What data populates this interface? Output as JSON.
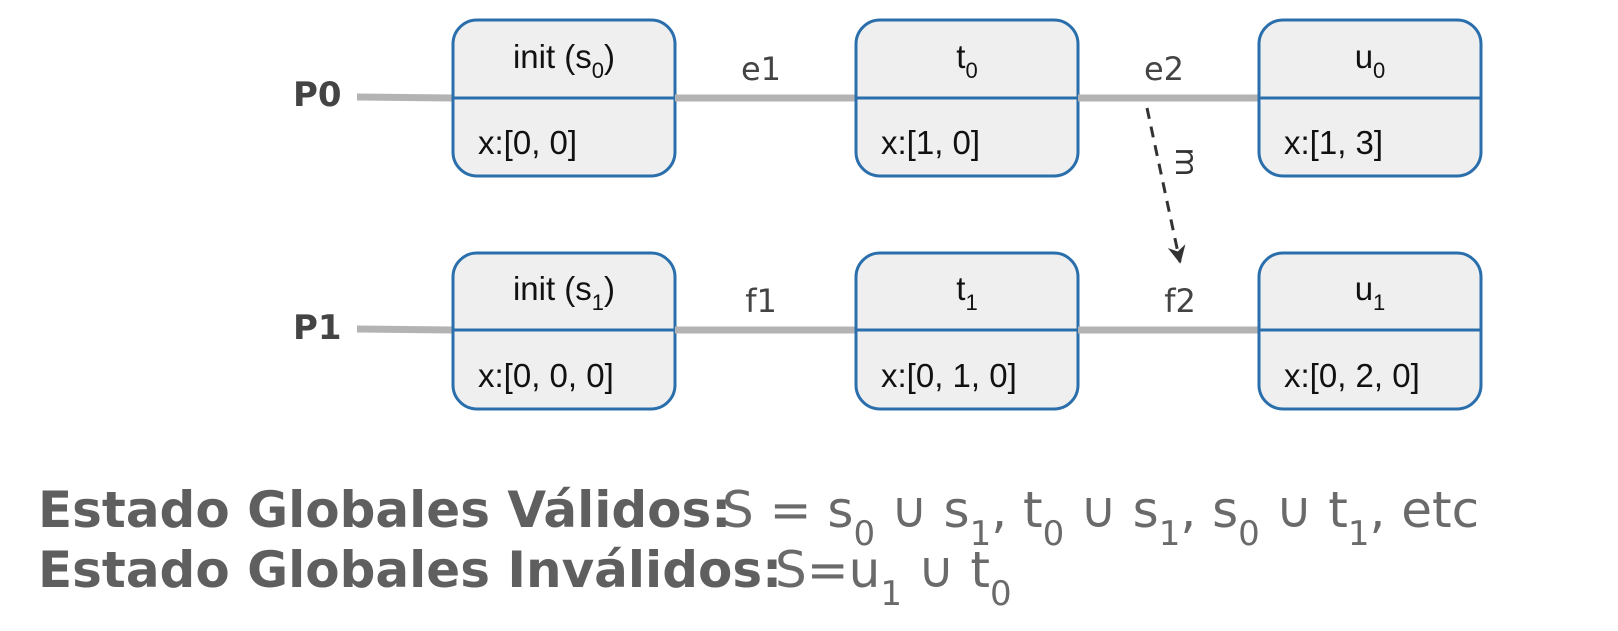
{
  "processes": [
    {
      "label": "P0",
      "states": [
        {
          "name": "init (s",
          "sub": "0",
          "suffix": ")",
          "vars": "x:[0, 0]"
        },
        {
          "name": "t",
          "sub": "0",
          "suffix": "",
          "vars": "x:[1, 0]"
        },
        {
          "name": "u",
          "sub": "0",
          "suffix": "",
          "vars": "x:[1, 3]"
        }
      ],
      "events": [
        "e1",
        "e2"
      ]
    },
    {
      "label": "P1",
      "states": [
        {
          "name": "init (s",
          "sub": "1",
          "suffix": ")",
          "vars": "x:[0, 0, 0]"
        },
        {
          "name": "t",
          "sub": "1",
          "suffix": "",
          "vars": "x:[0, 1, 0]"
        },
        {
          "name": "u",
          "sub": "1",
          "suffix": "",
          "vars": "x:[0, 2, 0]"
        }
      ],
      "events": [
        "f1",
        "f2"
      ]
    }
  ],
  "message": {
    "label": "m",
    "from": "e2",
    "to": "f2"
  },
  "colors": {
    "box_border": "#2a6fac",
    "box_fill": "#efefef",
    "arrow": "#b3b3b3",
    "message_arrow": "#333333",
    "label_gray": "#5f5f5f"
  },
  "valid": {
    "label": "Estado Globales Válidos:",
    "parts": [
      {
        "text": "S = s"
      },
      {
        "sub": "0"
      },
      {
        "text": " ∪ s"
      },
      {
        "sub": "1"
      },
      {
        "text": ", t"
      },
      {
        "sub": "0"
      },
      {
        "text": " ∪ s"
      },
      {
        "sub": "1"
      },
      {
        "text": ", s"
      },
      {
        "sub": "0"
      },
      {
        "text": " ∪ t"
      },
      {
        "sub": "1"
      },
      {
        "text": ", etc"
      }
    ]
  },
  "invalid": {
    "label": "Estado Globales Inválidos:",
    "parts": [
      {
        "text": "S=u"
      },
      {
        "sub": "1"
      },
      {
        "text": " ∪ t"
      },
      {
        "sub": "0"
      }
    ]
  }
}
